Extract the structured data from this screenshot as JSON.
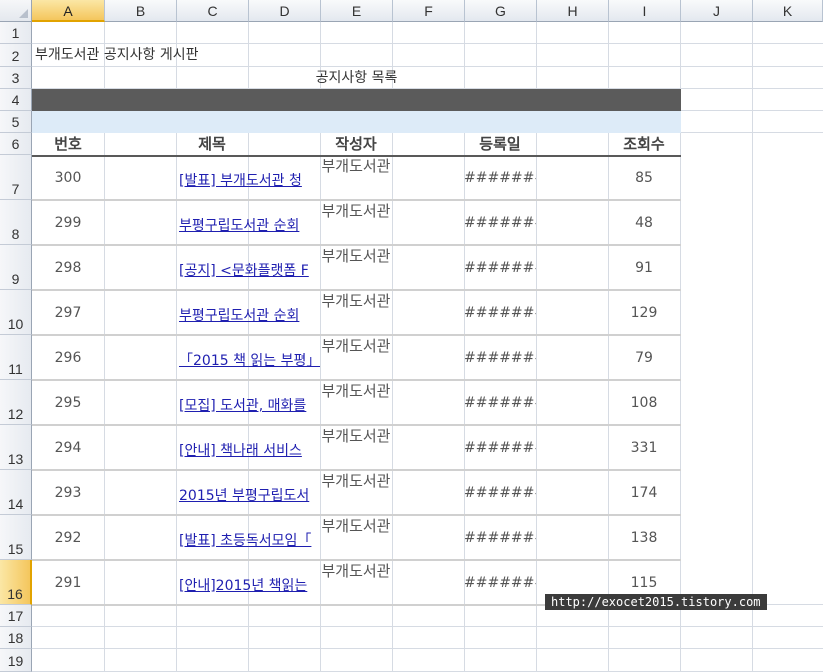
{
  "sheet": {
    "columns": [
      "A",
      "B",
      "C",
      "D",
      "E",
      "F",
      "G",
      "H",
      "I",
      "J",
      "K"
    ],
    "rows": [
      "1",
      "2",
      "3",
      "4",
      "5",
      "6",
      "7",
      "8",
      "9",
      "10",
      "11",
      "12",
      "13",
      "14",
      "15",
      "16",
      "17",
      "18",
      "19"
    ],
    "selected_column": "A",
    "selected_row": "16",
    "title": "부개도서관 공지사항 게시판",
    "subtitle": "공지사항 목록",
    "headers": {
      "no": "번호",
      "subject": "제목",
      "writer": "작성자",
      "date": "등록일",
      "views": "조회수"
    },
    "records": [
      {
        "no": "300",
        "subject": "[발표] 부개도서관 청",
        "writer": "부개도서관",
        "date": "#######",
        "views": "85"
      },
      {
        "no": "299",
        "subject": "부평구립도서관 순회",
        "writer": "부개도서관",
        "date": "#######",
        "views": "48"
      },
      {
        "no": "298",
        "subject": "[공지] <문화플랫폼 F",
        "writer": "부개도서관",
        "date": "#######",
        "views": "91"
      },
      {
        "no": "297",
        "subject": "부평구립도서관 순회",
        "writer": "부개도서관",
        "date": "#######",
        "views": "129"
      },
      {
        "no": "296",
        "subject": "「2015 책 읽는 부평」",
        "writer": "부개도서관",
        "date": "#######",
        "views": "79"
      },
      {
        "no": "295",
        "subject": "[모집] 도서관, 매화를",
        "writer": "부개도서관",
        "date": "#######",
        "views": "108"
      },
      {
        "no": "294",
        "subject": "[안내] 책나래 서비스",
        "writer": "부개도서관",
        "date": "#######",
        "views": "331"
      },
      {
        "no": "293",
        "subject": "2015년 부평구립도서",
        "writer": "부개도서관",
        "date": "#######",
        "views": "174"
      },
      {
        "no": "292",
        "subject": "[발표] 초등독서모임「",
        "writer": "부개도서관",
        "date": "#######",
        "views": "138"
      },
      {
        "no": "291",
        "subject": "[안내]2015년 책읽는",
        "writer": "부개도서관",
        "date": "#######",
        "views": "115"
      }
    ],
    "tooltip": "http://exocet2015.tistory.com"
  },
  "colors": {
    "header_band": "#5b5b5b",
    "light_band": "#ddebf8",
    "link": "#1f1fb0",
    "selection": "#f4c65d"
  }
}
